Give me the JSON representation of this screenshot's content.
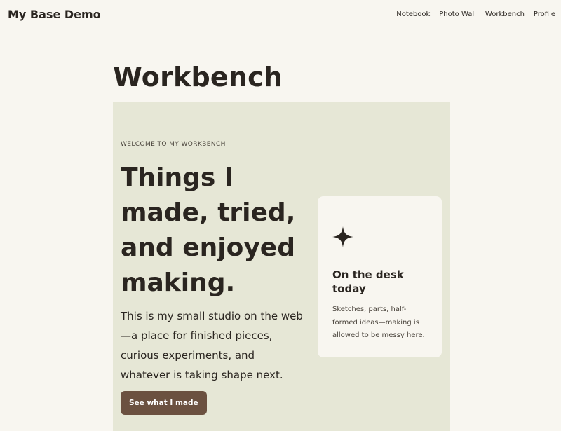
{
  "header": {
    "brand": "My Base Demo",
    "nav": [
      "Notebook",
      "Photo Wall",
      "Workbench",
      "Profile"
    ]
  },
  "page": {
    "title": "Workbench"
  },
  "hero": {
    "eyebrow": "WELCOME TO MY WORKBENCH",
    "headline": "Things I made, tried, and enjoyed making.",
    "lede": "This is my small studio on the web—a place for finished pieces, curious experiments, and whatever is taking shape next.",
    "cta_label": "See what I made"
  },
  "desk_card": {
    "icon": "sparkle-icon",
    "title": "On the desk today",
    "body": "Sketches, parts, half-formed ideas—making is allowed to be messy here."
  },
  "colors": {
    "background": "#f8f6f0",
    "hero_bg": "#e6e7d6",
    "button": "#6b5140",
    "text": "#2a2520"
  }
}
